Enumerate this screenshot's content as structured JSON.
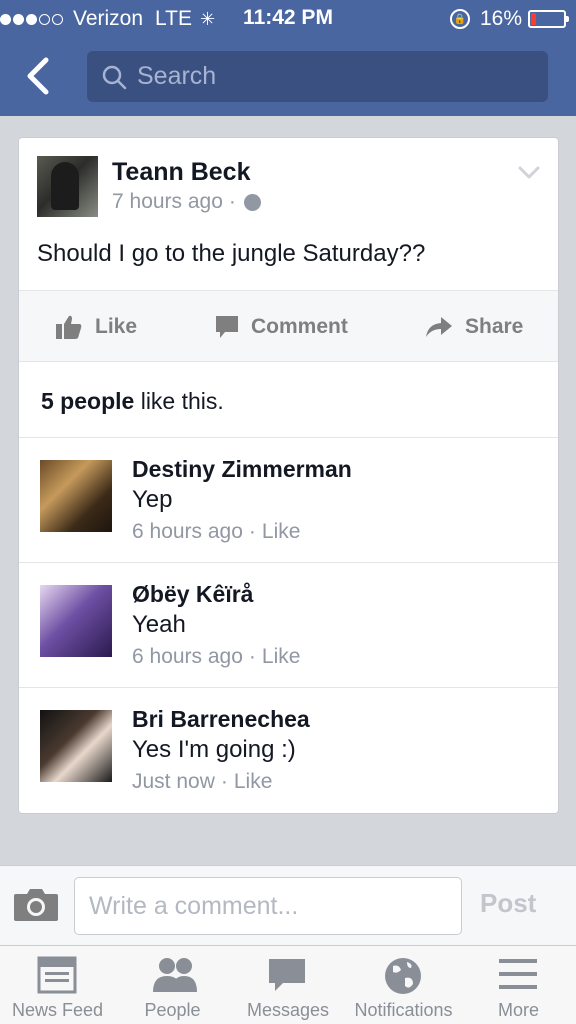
{
  "status_bar": {
    "carrier": "Verizon",
    "network": "LTE",
    "time": "11:42 PM",
    "battery_percent": "16%",
    "battery_level": 0.16,
    "signal_bars_filled": 3,
    "signal_bars_total": 5
  },
  "header": {
    "search_placeholder": "Search"
  },
  "post": {
    "author": "Teann Beck",
    "time": "7 hours ago",
    "meta_separator": "·",
    "text": "Should I go to the jungle Saturday??",
    "actions": {
      "like": "Like",
      "comment": "Comment",
      "share": "Share"
    },
    "likes": {
      "count_text": "5 people",
      "suffix": " like this."
    }
  },
  "comments": [
    {
      "name": "Destiny Zimmerman",
      "text": "Yep",
      "time": "6 hours ago",
      "like": "Like"
    },
    {
      "name": "Øbëy Kêïrå",
      "text": "Yeah",
      "time": "6 hours ago",
      "like": "Like"
    },
    {
      "name": "Bri Barrenechea",
      "text": "Yes I'm going :)",
      "time": "Just now",
      "like": "Like"
    }
  ],
  "composer": {
    "placeholder": "Write a comment...",
    "post_label": "Post"
  },
  "tabbar": {
    "tabs": [
      {
        "label": "News Feed",
        "icon": "news-feed-icon"
      },
      {
        "label": "People",
        "icon": "people-icon"
      },
      {
        "label": "Messages",
        "icon": "messages-icon"
      },
      {
        "label": "Notifications",
        "icon": "globe-icon"
      },
      {
        "label": "More",
        "icon": "menu-icon"
      }
    ]
  },
  "colors": {
    "header_blue": "#4a66a0",
    "search_bg": "#3a5080",
    "page_bg": "#d3d6db",
    "battery_red": "#ff3b30",
    "muted_text": "#9197a3"
  }
}
